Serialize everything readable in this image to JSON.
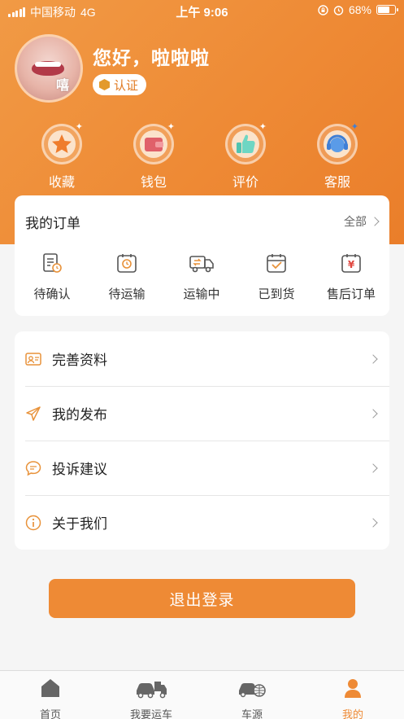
{
  "status_bar": {
    "carrier": "中国移动",
    "network": "4G",
    "time": "上午 9:06",
    "battery": "68%",
    "battery_level": 0.68
  },
  "profile": {
    "greeting": "您好，啦啦啦",
    "badge": "认证",
    "avatar_caption": "嘻"
  },
  "quick_links": [
    {
      "label": "收藏",
      "icon": "star-icon"
    },
    {
      "label": "钱包",
      "icon": "wallet-icon"
    },
    {
      "label": "评价",
      "icon": "thumbs-up-icon"
    },
    {
      "label": "客服",
      "icon": "headset-icon"
    }
  ],
  "orders": {
    "title": "我的订单",
    "all_label": "全部",
    "items": [
      {
        "label": "待确认",
        "icon": "document-clock-icon"
      },
      {
        "label": "待运输",
        "icon": "clock-icon"
      },
      {
        "label": "运输中",
        "icon": "truck-icon"
      },
      {
        "label": "已到货",
        "icon": "package-check-icon"
      },
      {
        "label": "售后订单",
        "icon": "yuan-receipt-icon"
      }
    ]
  },
  "menu": [
    {
      "label": "完善资料",
      "icon": "id-card-icon"
    },
    {
      "label": "我的发布",
      "icon": "paper-plane-icon"
    },
    {
      "label": "投诉建议",
      "icon": "chat-bubble-icon"
    },
    {
      "label": "关于我们",
      "icon": "info-icon"
    }
  ],
  "logout_label": "退出登录",
  "tabs": [
    {
      "label": "首页",
      "icon": "home-icon",
      "active": false
    },
    {
      "label": "我要运车",
      "icon": "car-truck-icon",
      "active": false
    },
    {
      "label": "车源",
      "icon": "car-globe-icon",
      "active": false
    },
    {
      "label": "我的",
      "icon": "user-icon",
      "active": true
    }
  ],
  "colors": {
    "accent": "#ee8a35",
    "icon_orange": "#e8923a"
  }
}
